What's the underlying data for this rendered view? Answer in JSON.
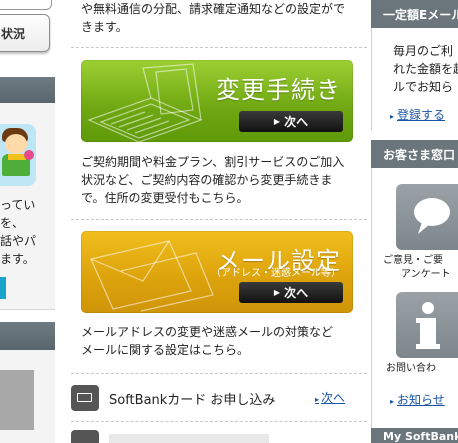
{
  "left": {
    "status_label": "状況",
    "text_lines": [
      "ってい",
      "を、",
      "話やパ",
      "ます。"
    ]
  },
  "main": {
    "intro_lines": [
      "や無料通信の分配、請求確定通知などの設定がで",
      "きます。"
    ],
    "change_banner": {
      "title": "変更手続き",
      "button_label": "次へ"
    },
    "change_desc_lines": [
      "ご契約期間や料金プラン、割引サービスのご加入",
      "状況など、ご契約内容の確認から変更手続きま",
      "で。住所の変更受付もこちら。"
    ],
    "mail_banner": {
      "title": "メール設定",
      "subtitle": "（アドレス・迷惑メール等）",
      "button_label": "次へ"
    },
    "mail_desc_lines": [
      "メールアドレスの変更や迷惑メールの対策など",
      "メールに関する設定はこちら。"
    ],
    "card_row": {
      "label": "SoftBankカード お申し込み",
      "link": "次へ"
    }
  },
  "right": {
    "header1": "一定額Eメール",
    "box1_lines": [
      "毎月のご利",
      "れた金額を超",
      "ルでお知ら"
    ],
    "link1": "登録する",
    "header2": "お客さま窓口",
    "tile1_caption_lines": [
      "ご意見・ご要",
      "アンケート"
    ],
    "tile2_caption": "お問い合わ",
    "link2": "お知らせ",
    "header3": "My SoftBank"
  },
  "colors": {
    "green_banner": "#7ab51d",
    "yellow_banner": "#e0a80e",
    "link": "#1a55a8",
    "header_gray": "#6a757c"
  }
}
